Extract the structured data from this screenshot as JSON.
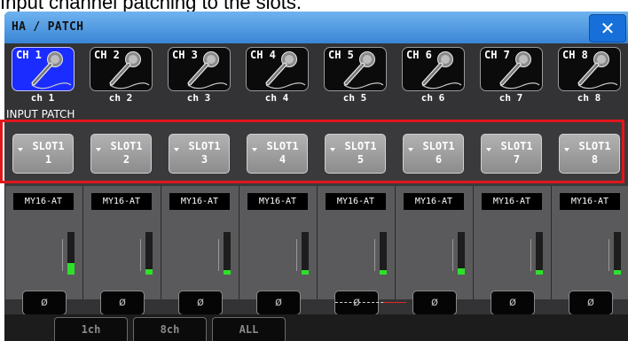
{
  "caption": "Input channel patching to the slots.",
  "window": {
    "title": "HA / PATCH",
    "close_icon": "✕"
  },
  "section_label": "INPUT PATCH",
  "channels": [
    {
      "button_label": "CH 1",
      "name": "ch 1",
      "patch_line1": "SLOT1",
      "patch_line2": "1",
      "ha_label": "MY16-AT",
      "meter_level": 0.28,
      "phase_symbol": "ø",
      "selected": true
    },
    {
      "button_label": "CH 2",
      "name": "ch 2",
      "patch_line1": "SLOT1",
      "patch_line2": "2",
      "ha_label": "MY16-AT",
      "meter_level": 0.12,
      "phase_symbol": "ø",
      "selected": false
    },
    {
      "button_label": "CH 3",
      "name": "ch 3",
      "patch_line1": "SLOT1",
      "patch_line2": "3",
      "ha_label": "MY16-AT",
      "meter_level": 0.1,
      "phase_symbol": "ø",
      "selected": false
    },
    {
      "button_label": "CH 4",
      "name": "ch 4",
      "patch_line1": "SLOT1",
      "patch_line2": "4",
      "ha_label": "MY16-AT",
      "meter_level": 0.1,
      "phase_symbol": "ø",
      "selected": false
    },
    {
      "button_label": "CH 5",
      "name": "ch 5",
      "patch_line1": "SLOT1",
      "patch_line2": "5",
      "ha_label": "MY16-AT",
      "meter_level": 0.1,
      "phase_symbol": "ø",
      "selected": false
    },
    {
      "button_label": "CH 6",
      "name": "ch 6",
      "patch_line1": "SLOT1",
      "patch_line2": "6",
      "ha_label": "MY16-AT",
      "meter_level": 0.14,
      "phase_symbol": "ø",
      "selected": false
    },
    {
      "button_label": "CH 7",
      "name": "ch 7",
      "patch_line1": "SLOT1",
      "patch_line2": "7",
      "ha_label": "MY16-AT",
      "meter_level": 0.1,
      "phase_symbol": "ø",
      "selected": false
    },
    {
      "button_label": "CH 8",
      "name": "ch 8",
      "patch_line1": "SLOT1",
      "patch_line2": "8",
      "ha_label": "MY16-AT",
      "meter_level": 0.1,
      "phase_symbol": "ø",
      "selected": false
    }
  ],
  "tabs": [
    {
      "label": "1ch",
      "active": false
    },
    {
      "label": "8ch",
      "active": true
    },
    {
      "label": "ALL",
      "active": false
    }
  ],
  "colors": {
    "title_bar": "#3a85d6",
    "selected_channel": "#1a2cff",
    "highlight_frame": "#e0161d",
    "meter": "#2ee02a",
    "active_tab_text": "#e8761c"
  },
  "icons": {
    "channel": "microphone-icon",
    "phase": "phase-icon",
    "patch_dropdown": "dropdown-arrow-icon"
  }
}
